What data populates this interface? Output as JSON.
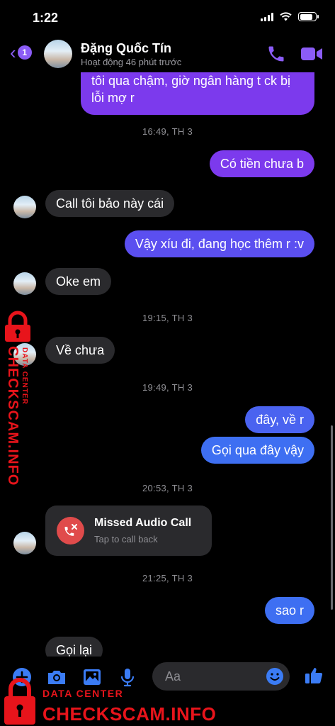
{
  "status_bar": {
    "time": "1:22"
  },
  "header": {
    "back_badge": "1",
    "name": "Đặng Quốc Tín",
    "status": "Hoạt động 46 phút trước"
  },
  "messages": {
    "m1_line1": "tôi qua chậm, giờ ngân hàng t ck bị",
    "m1_line2": "lỗi mợ r",
    "ts1": "16:49, TH 3",
    "m2": "Có tiền chưa b",
    "m3": "Call tôi bảo này cái",
    "m4": "Vậy xíu đi, đang học thêm r :v",
    "m5": "Oke em",
    "ts2": "19:15, TH 3",
    "m6": "Về chưa",
    "ts3": "19:49, TH 3",
    "m7": "đây, về r",
    "m8": "Gọi qua đây vậy",
    "ts4": "20:53, TH 3",
    "missed_title": "Missed Audio Call",
    "missed_sub": "Tap to call back",
    "ts5": "21:25, TH 3",
    "m9": "sao r",
    "m10": "Gọi lại"
  },
  "composer": {
    "placeholder": "Aa"
  },
  "watermark": {
    "side_text": "CHECKSCAM.INFO",
    "side_sub": "DATA CENTER",
    "bottom_sub": "DATA CENTER",
    "bottom_text": "CHECKSCAM.INFO"
  },
  "colors": {
    "accent": "#8b5cf6",
    "bubble_purple": "#7c3aed",
    "bubble_indigo": "#5b4ff0",
    "bubble_blue": "#3e6ff2",
    "composer_blue": "#3b7cf5",
    "incoming_bubble": "#2a2a2d",
    "missed_call_red": "#e04b4b",
    "watermark_red": "#e8141b"
  },
  "icons": {
    "back": "chevron-left-icon",
    "call": "phone-icon",
    "video": "video-camera-icon",
    "plus": "plus-icon",
    "camera": "camera-icon",
    "gallery": "image-icon",
    "mic": "microphone-icon",
    "emoji": "smiley-icon",
    "like": "thumbs-up-icon",
    "missed_call": "missed-call-icon",
    "watermark_lock": "padlock-icon"
  }
}
